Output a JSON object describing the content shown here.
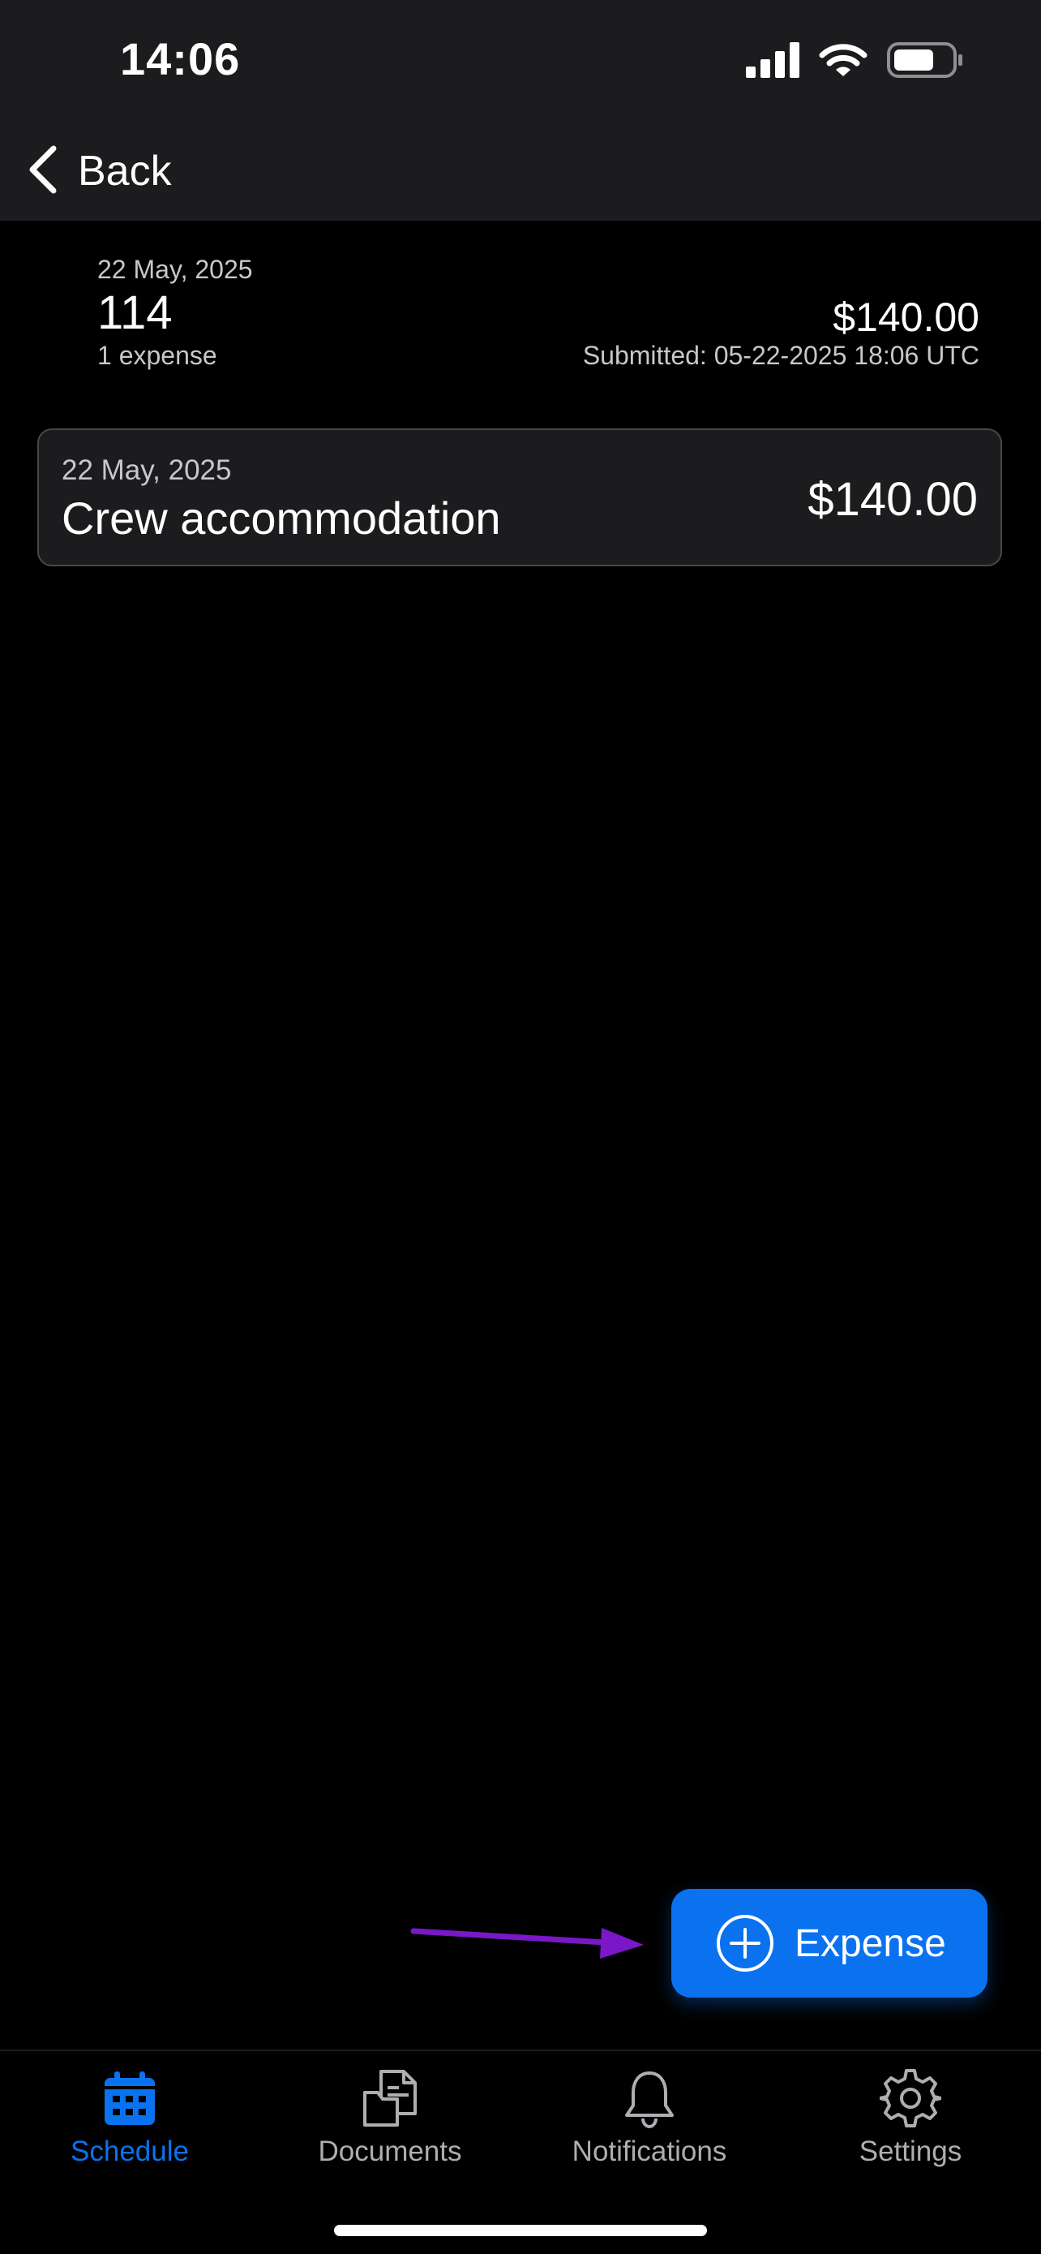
{
  "status_bar": {
    "time": "14:06"
  },
  "header": {
    "back_label": "Back"
  },
  "summary": {
    "date": "22 May, 2025",
    "id": "114",
    "expense_count": "1 expense",
    "total": "$140.00",
    "submitted": "Submitted: 05-22-2025 18:06 UTC"
  },
  "expenses": [
    {
      "date": "22 May, 2025",
      "title": "Crew accommodation",
      "amount": "$140.00"
    }
  ],
  "fab": {
    "label": "Expense",
    "icon": "plus-circle-icon"
  },
  "tabs": [
    {
      "label": "Schedule",
      "icon": "calendar-icon",
      "active": true
    },
    {
      "label": "Documents",
      "icon": "documents-icon",
      "active": false
    },
    {
      "label": "Notifications",
      "icon": "bell-icon",
      "active": false
    },
    {
      "label": "Settings",
      "icon": "gear-icon",
      "active": false
    }
  ],
  "colors": {
    "accent": "#0a72ef",
    "background": "#000000",
    "surface": "#1c1c1e",
    "annotation_arrow": "#7a17c9"
  }
}
